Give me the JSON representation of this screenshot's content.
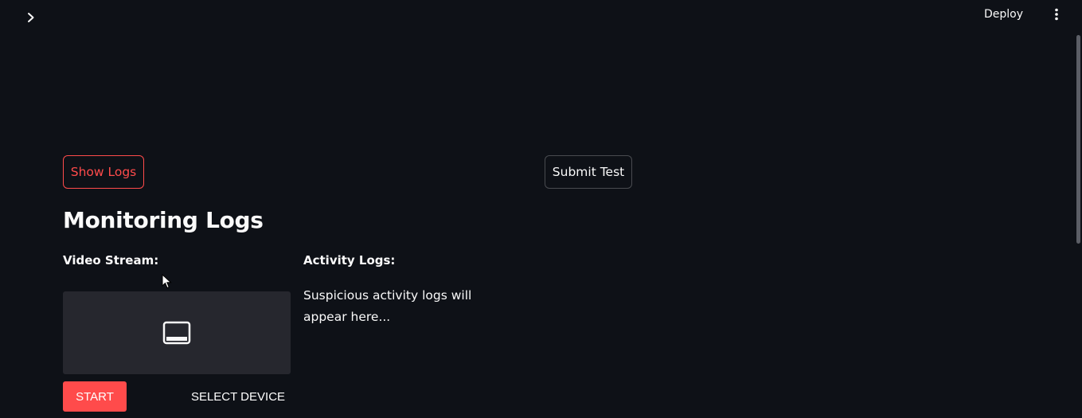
{
  "header": {
    "deploy_label": "Deploy",
    "sidebar_toggle_icon": "chevron-right-icon",
    "menu_icon": "vertical-ellipsis-icon"
  },
  "actions": {
    "show_logs_label": "Show Logs",
    "submit_test_label": "Submit Test"
  },
  "main": {
    "heading": "Monitoring Logs",
    "video_stream_label": "Video Stream:",
    "activity_logs_label": "Activity Logs:",
    "activity_logs_placeholder": "Suspicious activity logs will appear here..."
  },
  "video": {
    "placeholder_icon": "camera-screen-icon",
    "start_label": "START",
    "select_device_label": "SELECT DEVICE"
  },
  "colors": {
    "background": "#0e1117",
    "accent": "#ff4b4b",
    "video_box": "#26272e",
    "text": "#fafafa"
  }
}
